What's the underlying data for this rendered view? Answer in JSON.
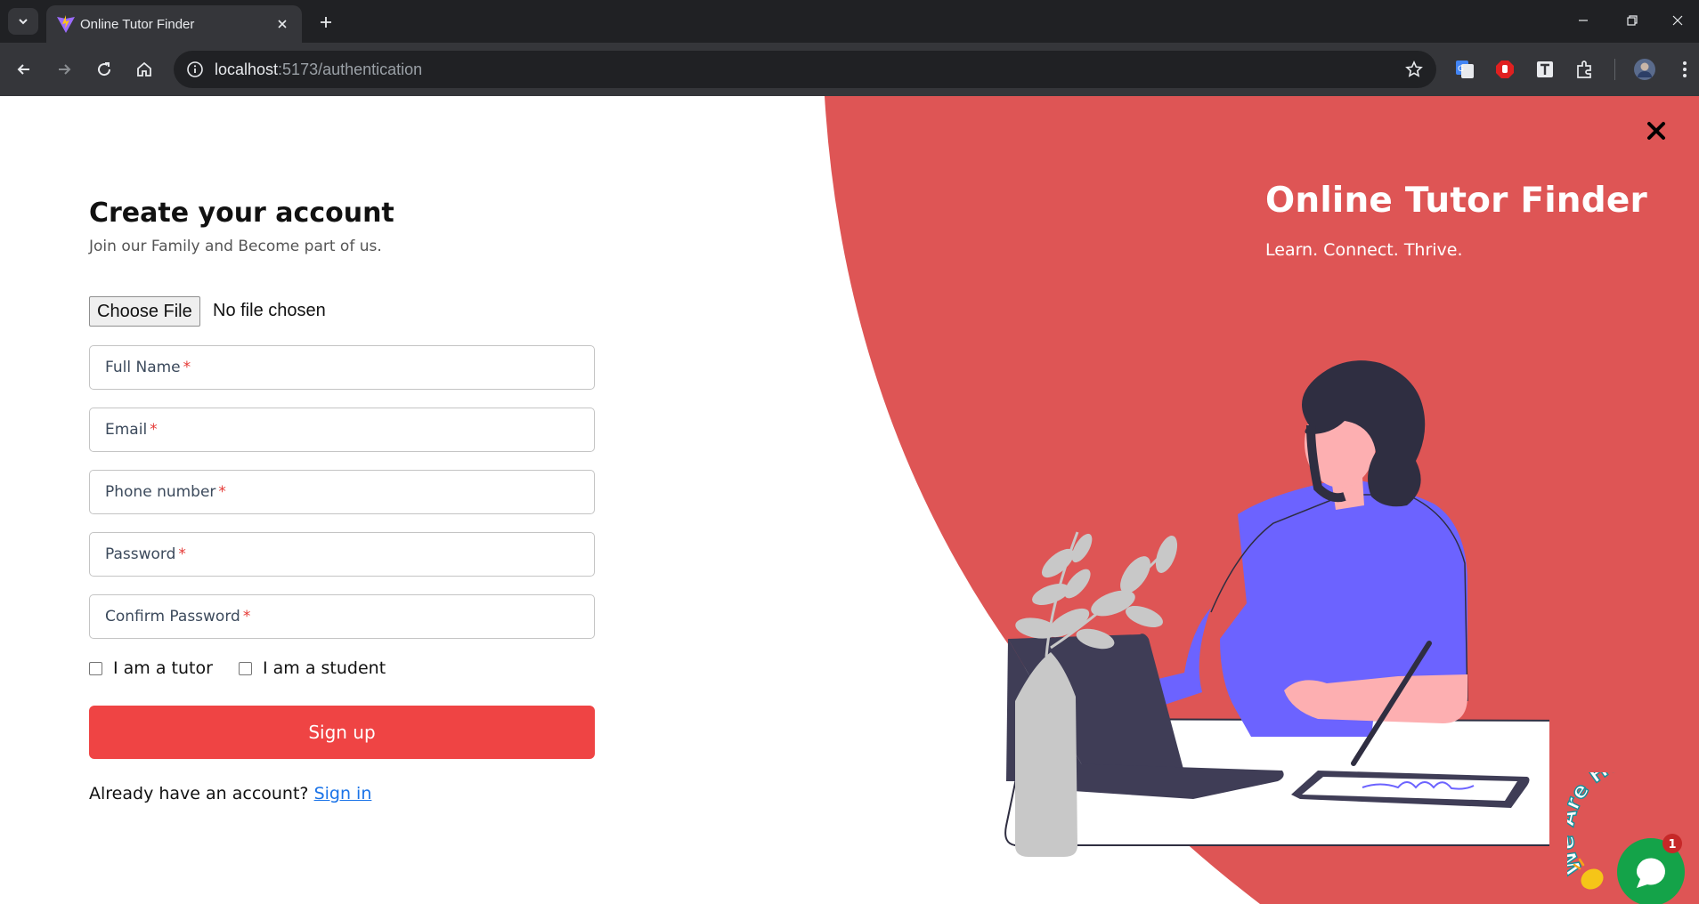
{
  "browser": {
    "tab_title": "Online Tutor Finder",
    "url_host": "localhost",
    "url_path": ":5173/authentication"
  },
  "brand": {
    "title": "Online Tutor Finder",
    "tagline": "Learn. Connect. Thrive."
  },
  "form": {
    "heading": "Create your account",
    "subheading": "Join our Family and Become part of us.",
    "file_button": "Choose File",
    "file_status": "No file chosen",
    "fields": [
      {
        "label": "Full Name",
        "required": "*"
      },
      {
        "label": "Email",
        "required": "*"
      },
      {
        "label": "Phone number",
        "required": "*"
      },
      {
        "label": "Password",
        "required": "*"
      },
      {
        "label": "Confirm Password",
        "required": "*"
      }
    ],
    "checkboxes": [
      {
        "label": "I am a tutor",
        "checked": false
      },
      {
        "label": "I am a student",
        "checked": false
      }
    ],
    "submit_label": "Sign up",
    "signin_prompt": "Already have an account?",
    "signin_link": "Sign in"
  },
  "chat_widget": {
    "badge_text": "We Are Here!",
    "unread_count": "1"
  },
  "colors": {
    "accent_red": "#ef4444",
    "panel_red": "#de5555",
    "shirt_purple": "#6c63ff",
    "hair_dark": "#2f2e41",
    "chat_green": "#14a349"
  }
}
